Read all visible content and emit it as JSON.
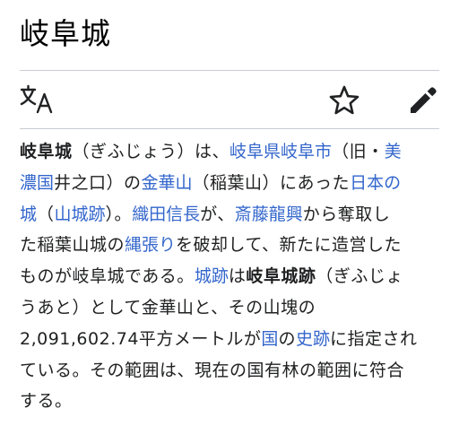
{
  "page": {
    "title": "岐阜城"
  },
  "toolbar": {
    "language_icon": "translate-icon",
    "watch_icon": "star-outline-icon",
    "edit_icon": "pencil-icon"
  },
  "colors": {
    "link": "#3366cc",
    "text": "#202122",
    "rule": "#c8ccd1"
  },
  "article": {
    "lines": [
      {
        "segments": [
          {
            "text": "岐阜城",
            "kind": "bold"
          },
          {
            "text": "（ぎふじょう）は、",
            "kind": "text"
          },
          {
            "text": "岐阜県",
            "kind": "link"
          },
          {
            "text": "岐阜市",
            "kind": "link"
          },
          {
            "text": "（旧・",
            "kind": "text"
          },
          {
            "text": "美",
            "kind": "link"
          }
        ]
      },
      {
        "segments": [
          {
            "text": "濃国",
            "kind": "link"
          },
          {
            "text": "井之口）の",
            "kind": "text"
          },
          {
            "text": "金華山",
            "kind": "link"
          },
          {
            "text": "（稲葉山）にあった",
            "kind": "text"
          },
          {
            "text": "日本の",
            "kind": "link"
          }
        ]
      },
      {
        "segments": [
          {
            "text": "城",
            "kind": "link"
          },
          {
            "text": "（",
            "kind": "text"
          },
          {
            "text": "山城跡",
            "kind": "link"
          },
          {
            "text": "）。",
            "kind": "text"
          },
          {
            "text": "織田信長",
            "kind": "link"
          },
          {
            "text": "が、",
            "kind": "text"
          },
          {
            "text": "斎藤龍興",
            "kind": "link"
          },
          {
            "text": "から奪取し",
            "kind": "text"
          }
        ]
      },
      {
        "segments": [
          {
            "text": "た稲葉山城の",
            "kind": "text"
          },
          {
            "text": "縄張り",
            "kind": "link"
          },
          {
            "text": "を破却して、新たに造営した",
            "kind": "text"
          }
        ]
      },
      {
        "segments": [
          {
            "text": "ものが岐阜城である。",
            "kind": "text"
          },
          {
            "text": "城跡",
            "kind": "link"
          },
          {
            "text": "は",
            "kind": "text"
          },
          {
            "text": "岐阜城跡",
            "kind": "bold"
          },
          {
            "text": "（ぎふじょ",
            "kind": "text"
          }
        ]
      },
      {
        "segments": [
          {
            "text": "うあと）として金華山と、その山塊の",
            "kind": "text"
          }
        ]
      },
      {
        "segments": [
          {
            "text": "2,091,602.74平方メートルが",
            "kind": "text"
          },
          {
            "text": "国",
            "kind": "link"
          },
          {
            "text": "の",
            "kind": "text"
          },
          {
            "text": "史跡",
            "kind": "link"
          },
          {
            "text": "に指定され",
            "kind": "text"
          }
        ]
      },
      {
        "segments": [
          {
            "text": "ている。その範囲は、現在の国有林の範囲に符合",
            "kind": "text"
          }
        ]
      },
      {
        "segments": [
          {
            "text": "する。",
            "kind": "text"
          }
        ]
      }
    ]
  }
}
